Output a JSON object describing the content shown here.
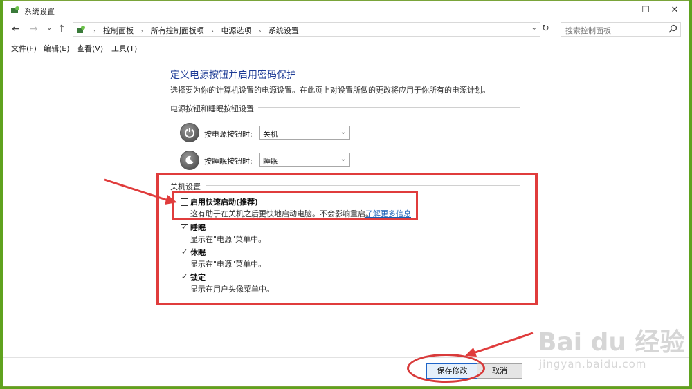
{
  "window": {
    "title": "系统设置",
    "controls": {
      "minimize": "—",
      "maximize": "☐",
      "close": "✕"
    }
  },
  "nav": {
    "back": "←",
    "forward": "→",
    "recent": "⌄",
    "up": "↑",
    "breadcrumbs": [
      "控制面板",
      "所有控制面板项",
      "电源选项",
      "系统设置"
    ],
    "separator": "›",
    "dropdown": "⌄",
    "refresh": "↻",
    "search_placeholder": "搜索控制面板"
  },
  "menu": [
    "文件(F)",
    "编辑(E)",
    "查看(V)",
    "工具(T)"
  ],
  "content": {
    "heading": "定义电源按钮并启用密码保护",
    "description": "选择要为你的计算机设置的电源设置。在此页上对设置所做的更改将应用于你所有的电源计划。",
    "power_group_title": "电源按钮和睡眠按钮设置",
    "power_button_label": "按电源按钮时:",
    "power_button_value": "关机",
    "sleep_button_label": "按睡眠按钮时:",
    "sleep_button_value": "睡眠",
    "shutdown_group_title": "关机设置",
    "checkboxes": [
      {
        "label": "启用快速启动(推荐)",
        "desc": "这有助于在关机之后更快地启动电脑。不会影响重启。",
        "checked": false,
        "link": "了解更多信息"
      },
      {
        "label": "睡眠",
        "desc": "显示在\"电源\"菜单中。",
        "checked": true
      },
      {
        "label": "休眠",
        "desc": "显示在\"电源\"菜单中。",
        "checked": true
      },
      {
        "label": "锁定",
        "desc": "显示在用户头像菜单中。",
        "checked": true
      }
    ],
    "check_mark": "✓",
    "combo_arrow": "⌄"
  },
  "footer": {
    "save": "保存修改",
    "cancel": "取消"
  },
  "watermark": {
    "brand": "Bai du 经验",
    "url": "jingyan.baidu.com"
  },
  "colors": {
    "annotation": "#e03c3c",
    "heading": "#1e3c96",
    "link": "#1a5fb4",
    "background": "#5fa21e"
  }
}
